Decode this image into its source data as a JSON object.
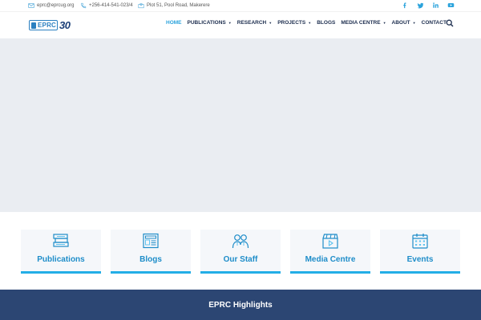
{
  "topbar": {
    "email": "eprc@eprcug.org",
    "phone": "+256-414-541-023/4",
    "address": "Plot 51, Pool Road, Makerere",
    "socials": [
      "facebook-icon",
      "twitter-icon",
      "linkedin-icon",
      "youtube-icon"
    ]
  },
  "header": {
    "logo_text": "EPRC",
    "logo_anniversary": "30",
    "nav": [
      {
        "label": "HOME",
        "active": true,
        "dropdown": false
      },
      {
        "label": "PUBLICATIONS",
        "active": false,
        "dropdown": true
      },
      {
        "label": "RESEARCH",
        "active": false,
        "dropdown": true
      },
      {
        "label": "PROJECTS",
        "active": false,
        "dropdown": true
      },
      {
        "label": "BLOGS",
        "active": false,
        "dropdown": false
      },
      {
        "label": "MEDIA CENTRE",
        "active": false,
        "dropdown": true
      },
      {
        "label": "ABOUT",
        "active": false,
        "dropdown": true
      },
      {
        "label": "CONTACT",
        "active": false,
        "dropdown": false
      }
    ],
    "caret": "▼"
  },
  "cards": [
    {
      "label": "Publications",
      "icon": "books-icon"
    },
    {
      "label": "Blogs",
      "icon": "newspaper-icon"
    },
    {
      "label": "Our Staff",
      "icon": "staff-icon"
    },
    {
      "label": "Media Centre",
      "icon": "clapperboard-icon"
    },
    {
      "label": "Events",
      "icon": "calendar-icon"
    }
  ],
  "highlights": {
    "title": "EPRC Highlights"
  },
  "colors": {
    "accent": "#2ba3dc",
    "nav_text": "#1d2e4f",
    "card_label": "#1e8dc9",
    "banner": "#2c4673",
    "hero": "#eaedf2"
  }
}
